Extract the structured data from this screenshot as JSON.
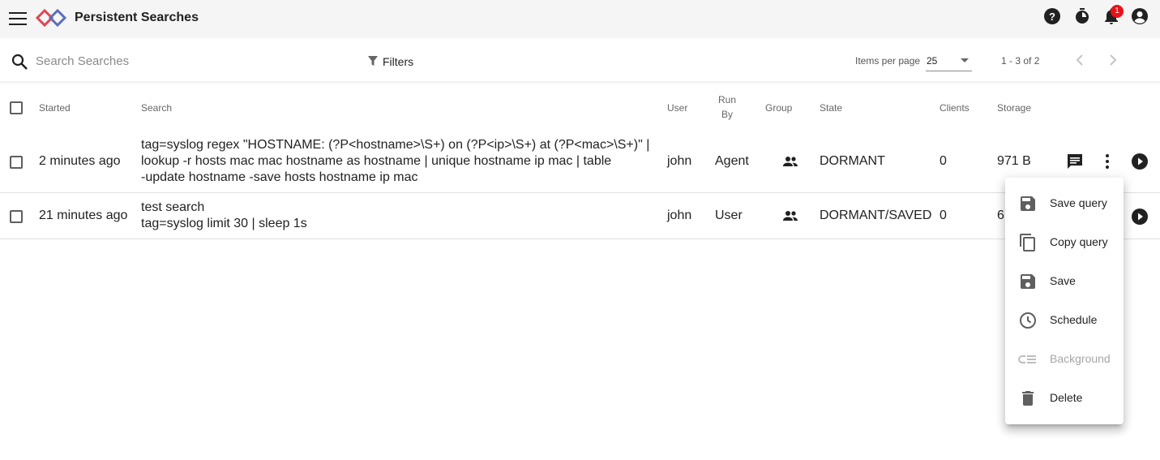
{
  "app": {
    "title": "Persistent Searches"
  },
  "header": {
    "icons": [
      "menu-icon",
      "gravwell-logo",
      "help-icon",
      "timer-icon",
      "notifications-icon",
      "account-icon"
    ],
    "notification_count": "1",
    "badge_color": "#e8121a"
  },
  "toolbar": {
    "search_placeholder": "Search Searches",
    "filters_label": "Filters",
    "items_per_page_label": "Items per page",
    "items_per_page_value": "25",
    "range_label": "1 - 3 of 2"
  },
  "table": {
    "columns": {
      "started": "Started",
      "search": "Search",
      "user": "User",
      "run_by_1": "Run",
      "run_by_2": "By",
      "group": "Group",
      "state": "State",
      "clients": "Clients",
      "storage": "Storage"
    },
    "rows": [
      {
        "started": "2 minutes ago",
        "search_lines": [
          "tag=syslog regex \"HOSTNAME: (?P<hostname>\\S+) on (?P<ip>\\S+) at (?P<mac>\\S+)\" |",
          "lookup -r hosts mac mac hostname as hostname | unique hostname ip mac | table",
          "-update hostname -save hosts hostname ip mac"
        ],
        "user": "john",
        "run_by": "Agent",
        "state": "DORMANT",
        "clients": "0",
        "storage": "971 B"
      },
      {
        "started": "21 minutes ago",
        "search_lines": [
          "test search",
          "tag=syslog limit 30 | sleep 1s"
        ],
        "user": "john",
        "run_by": "User",
        "state": "DORMANT/SAVED",
        "clients": "0",
        "storage": "6"
      }
    ]
  },
  "context_menu": {
    "items": [
      {
        "label": "Save query",
        "icon": "save-icon",
        "disabled": false
      },
      {
        "label": "Copy query",
        "icon": "copy-icon",
        "disabled": false
      },
      {
        "label": "Save",
        "icon": "save-icon",
        "disabled": false
      },
      {
        "label": "Schedule",
        "icon": "clock-icon",
        "disabled": false
      },
      {
        "label": "Background",
        "icon": "background-icon",
        "disabled": true
      },
      {
        "label": "Delete",
        "icon": "trash-icon",
        "disabled": false
      }
    ]
  },
  "colors": {
    "topbar_bg": "#f5f5f5",
    "logo_red": "#e0454f",
    "logo_blue": "#5a6fb8",
    "icon_dark": "#212121"
  }
}
